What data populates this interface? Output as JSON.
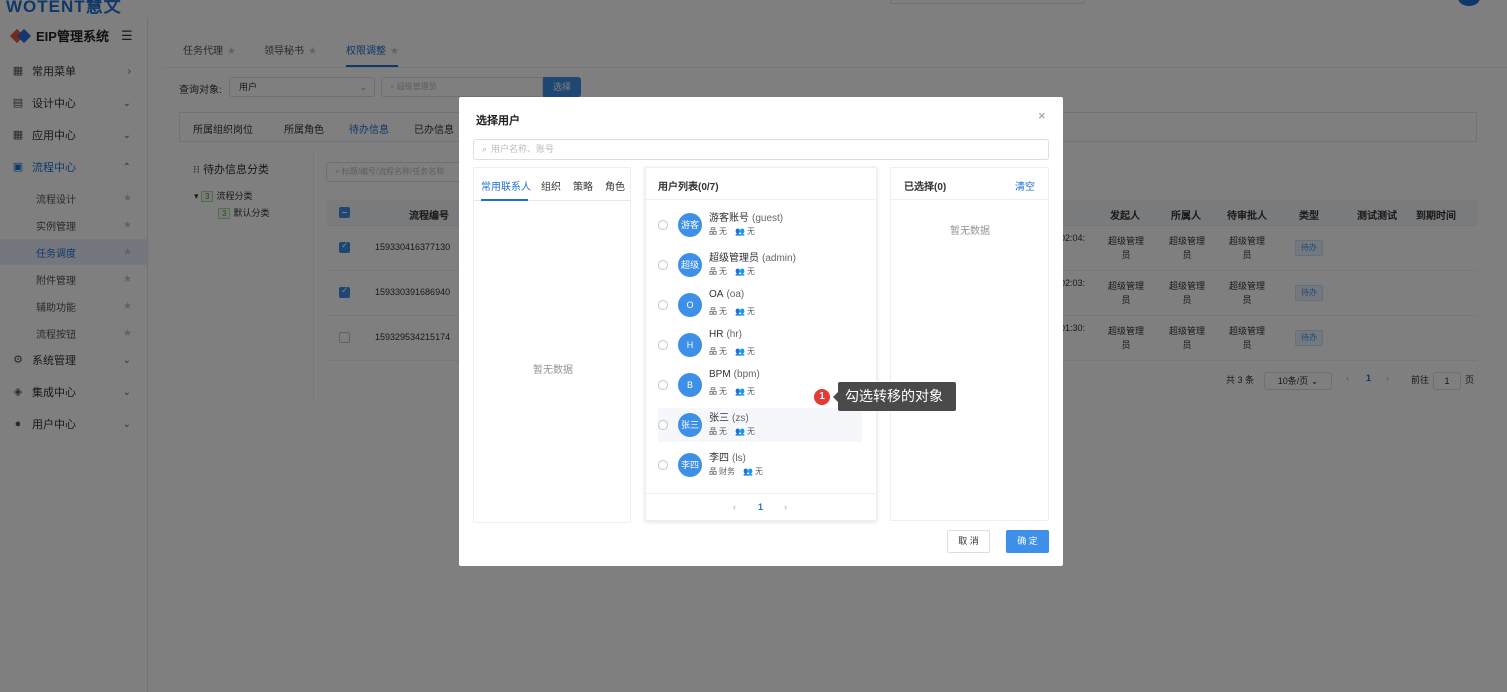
{
  "app": {
    "logo_text": "WOTENT慧文",
    "brand": "EIP管理系统",
    "menu_toggle": "☰"
  },
  "sidebar": {
    "items": [
      {
        "label": "常用菜单",
        "icon": "grid-icon",
        "chev": "›"
      },
      {
        "label": "设计中心",
        "icon": "design-icon",
        "chev": "⌄"
      },
      {
        "label": "应用中心",
        "icon": "apps-icon",
        "chev": "⌄"
      },
      {
        "label": "流程中心",
        "icon": "flow-icon",
        "chev": "⌃"
      },
      {
        "label": "系统管理",
        "icon": "gear-icon",
        "chev": "⌄"
      },
      {
        "label": "集成中心",
        "icon": "layers-icon",
        "chev": "⌄"
      },
      {
        "label": "用户中心",
        "icon": "user-icon",
        "chev": "⌄"
      }
    ],
    "sub_items": [
      "流程设计",
      "实例管理",
      "任务调度",
      "附件管理",
      "辅助功能",
      "流程按钮"
    ]
  },
  "tabs": [
    "任务代理",
    "领导秘书",
    "权限调整"
  ],
  "query": {
    "label": "查询对象:",
    "select_value": "用户",
    "input_placeholder": "超级管理员",
    "button": "选择"
  },
  "subtabs": [
    "所属组织岗位",
    "所属角色",
    "待办信息",
    "已办信息"
  ],
  "category": {
    "title": "待办信息分类",
    "tree": [
      {
        "count": "3",
        "label": "流程分类"
      },
      {
        "count": "3",
        "label": "默认分类"
      }
    ]
  },
  "list_search_placeholder": "标题/编号/流程名称/任务名称",
  "grid": {
    "headers": [
      "流程编号",
      "发起人",
      "所属人",
      "待审批人",
      "类型",
      "测试测试",
      "到期时间"
    ],
    "rows": [
      {
        "checked": true,
        "id": "159330416377130",
        "time": "02:04:",
        "starter": "超级管理员",
        "owner": "超级管理员",
        "approver": "超级管理员",
        "type": "待办"
      },
      {
        "checked": true,
        "id": "159330391686940",
        "time": "02:03:",
        "starter": "超级管理员",
        "owner": "超级管理员",
        "approver": "超级管理员",
        "type": "待办"
      },
      {
        "checked": false,
        "id": "159329534215174",
        "time": "01:30:",
        "starter": "超级管理员",
        "owner": "超级管理员",
        "approver": "超级管理员",
        "type": "待办"
      }
    ],
    "pager": {
      "total": "共 3 条",
      "size": "10条/页",
      "page": "1",
      "goto_label": "前往",
      "goto_value": "1",
      "page_suffix": "页"
    }
  },
  "dialog": {
    "title": "选择用户",
    "close": "×",
    "search_placeholder": "用户名称、账号",
    "left_tabs": [
      "常用联系人",
      "组织",
      "策略",
      "角色"
    ],
    "left_empty": "暂无数据",
    "list_title": "用户列表(0/7)",
    "users": [
      {
        "avatar": "游客",
        "name": "游客账号",
        "account": "(guest)",
        "org": "无",
        "role": "无"
      },
      {
        "avatar": "超级",
        "name": "超级管理员",
        "account": "(admin)",
        "org": "无",
        "role": "无"
      },
      {
        "avatar": "O",
        "name": "OA",
        "account": "(oa)",
        "org": "无",
        "role": "无"
      },
      {
        "avatar": "H",
        "name": "HR",
        "account": "(hr)",
        "org": "无",
        "role": "无"
      },
      {
        "avatar": "B",
        "name": "BPM",
        "account": "(bpm)",
        "org": "无",
        "role": "无"
      },
      {
        "avatar": "张三",
        "name": "张三",
        "account": "(zs)",
        "org": "无",
        "role": "无"
      },
      {
        "avatar": "李四",
        "name": "李四",
        "account": "(ls)",
        "org": "财务",
        "role": "无"
      }
    ],
    "pager": {
      "prev": "‹",
      "page": "1",
      "next": "›"
    },
    "selected_title": "已选择(0)",
    "clear": "清空",
    "right_empty": "暂无数据",
    "cancel": "取 消",
    "ok": "确 定"
  },
  "annotation": {
    "step": "1",
    "text": "勾选转移的对象"
  },
  "colors": {
    "primary": "#3d8fe8",
    "accent_blue": "#1f6fd4",
    "step_red": "#e53935"
  }
}
